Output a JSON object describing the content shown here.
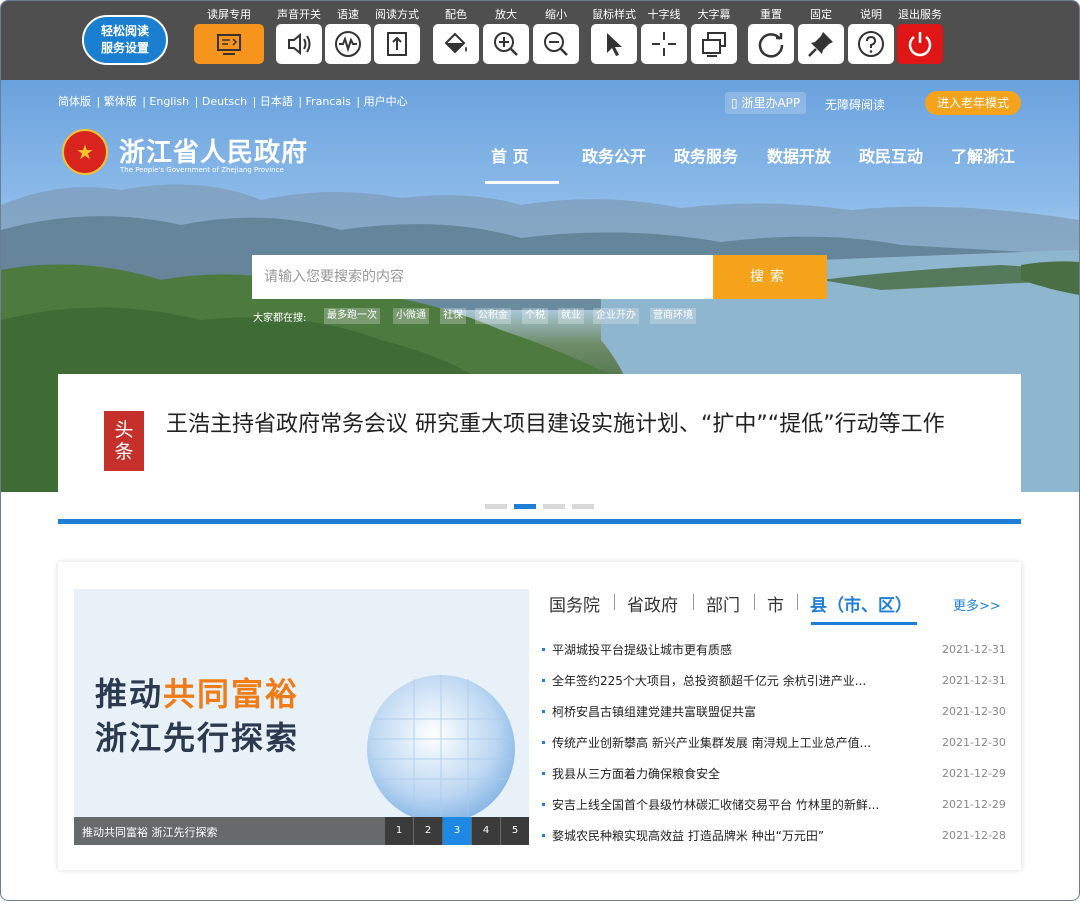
{
  "toolbar": {
    "easy_read_line1": "轻松阅读",
    "easy_read_line2": "服务设置",
    "tools": [
      {
        "label": "读屏专用",
        "icon": "screen-reader-icon"
      },
      {
        "label": "声音开关",
        "icon": "speaker-icon"
      },
      {
        "label": "语速",
        "icon": "speech-rate-icon"
      },
      {
        "label": "阅读方式",
        "icon": "reading-mode-icon"
      },
      {
        "label": "配色",
        "icon": "color-fill-icon"
      },
      {
        "label": "放大",
        "icon": "zoom-in-icon"
      },
      {
        "label": "缩小",
        "icon": "zoom-out-icon"
      },
      {
        "label": "鼠标样式",
        "icon": "cursor-icon"
      },
      {
        "label": "十字线",
        "icon": "crosshair-icon"
      },
      {
        "label": "大字幕",
        "icon": "caption-icon"
      },
      {
        "label": "重置",
        "icon": "reset-icon"
      },
      {
        "label": "固定",
        "icon": "pin-icon"
      },
      {
        "label": "说明",
        "icon": "help-icon"
      },
      {
        "label": "退出服务",
        "icon": "power-icon"
      }
    ]
  },
  "header": {
    "languages": [
      "简体版",
      "繁体版",
      "English",
      "Deutsch",
      "日本語",
      "Francais",
      "用户中心"
    ],
    "app_link": "浙里办APP",
    "no_barrier": "无障碍阅读",
    "elder_mode": "进入老年模式",
    "gov_name": "浙江省人民政府",
    "gov_name_en": "The People's Government of Zhejiang Province",
    "nav": [
      "首 页",
      "政务公开",
      "政务服务",
      "数据开放",
      "政民互动",
      "了解浙江"
    ]
  },
  "search": {
    "placeholder": "请输入您要搜索的内容",
    "button": "搜索",
    "hot_label": "大家都在搜:",
    "hot_tags": [
      "最多跑一次",
      "小微通",
      "社保",
      "公积金",
      "个税",
      "就业",
      "企业开办",
      "营商环境"
    ]
  },
  "headline": {
    "badge_top": "头",
    "badge_bottom": "条",
    "text": "王浩主持省政府常务会议 研究重大项目建设实施计划、“扩中”“提低”行动等工作",
    "active_slide": 2
  },
  "news": {
    "promo": {
      "line1_plain": "推动",
      "line1_highlight": "共同富裕",
      "line2": "浙江先行探索",
      "caption": "推动共同富裕 浙江先行探索",
      "pages": [
        "1",
        "2",
        "3",
        "4",
        "5"
      ],
      "active_page": 3
    },
    "tabs": [
      "国务院",
      "省政府",
      "部门",
      "市",
      "县（市、区）"
    ],
    "active_tab": 4,
    "more": "更多>>",
    "items": [
      {
        "title": "平湖城投平台提级让城市更有质感",
        "date": "2021-12-31"
      },
      {
        "title": "全年签约225个大项目，总投资额超千亿元 余杭引进产业...",
        "date": "2021-12-31"
      },
      {
        "title": "柯桥安昌古镇组建党建共富联盟促共富",
        "date": "2021-12-30"
      },
      {
        "title": "传统产业创新攀高 新兴产业集群发展 南浔规上工业总产值...",
        "date": "2021-12-30"
      },
      {
        "title": "我县从三方面着力确保粮食安全",
        "date": "2021-12-29"
      },
      {
        "title": "安吉上线全国首个县级竹林碳汇收储交易平台 竹林里的新鲜...",
        "date": "2021-12-29"
      },
      {
        "title": "婺城农民种粮实现高效益 打造品牌米 种出“万元田”",
        "date": "2021-12-28"
      }
    ]
  },
  "colors": {
    "accent_blue": "#1f7fd6",
    "orange": "#f5a31a",
    "badge_red": "#c6302b"
  }
}
